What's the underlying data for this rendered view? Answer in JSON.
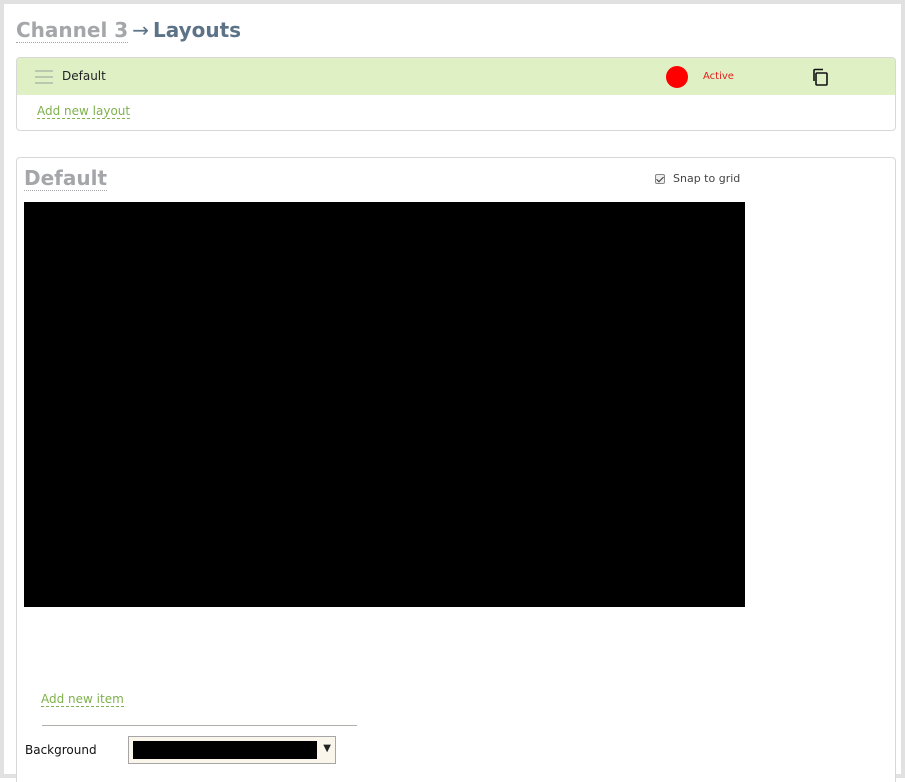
{
  "breadcrumb": {
    "channel": "Channel 3",
    "arrow": "→",
    "current": "Layouts"
  },
  "layouts": {
    "items": [
      {
        "name": "Default",
        "status": "Active",
        "status_color": "#ff0000"
      }
    ],
    "add_label": "Add new layout"
  },
  "editor": {
    "title": "Default",
    "snap_label": "Snap to grid",
    "snap_checked": true,
    "canvas_color": "#000000",
    "add_item_label": "Add new item",
    "background_label": "Background",
    "background_value": "#000000"
  },
  "colors": {
    "row_highlight": "#dff0c5",
    "link": "#7fb14d",
    "active_text": "#e0201c"
  },
  "icons": {
    "drag": "drag-handle-icon",
    "copy": "copy-icon",
    "dropdown": "chevron-down-icon"
  }
}
